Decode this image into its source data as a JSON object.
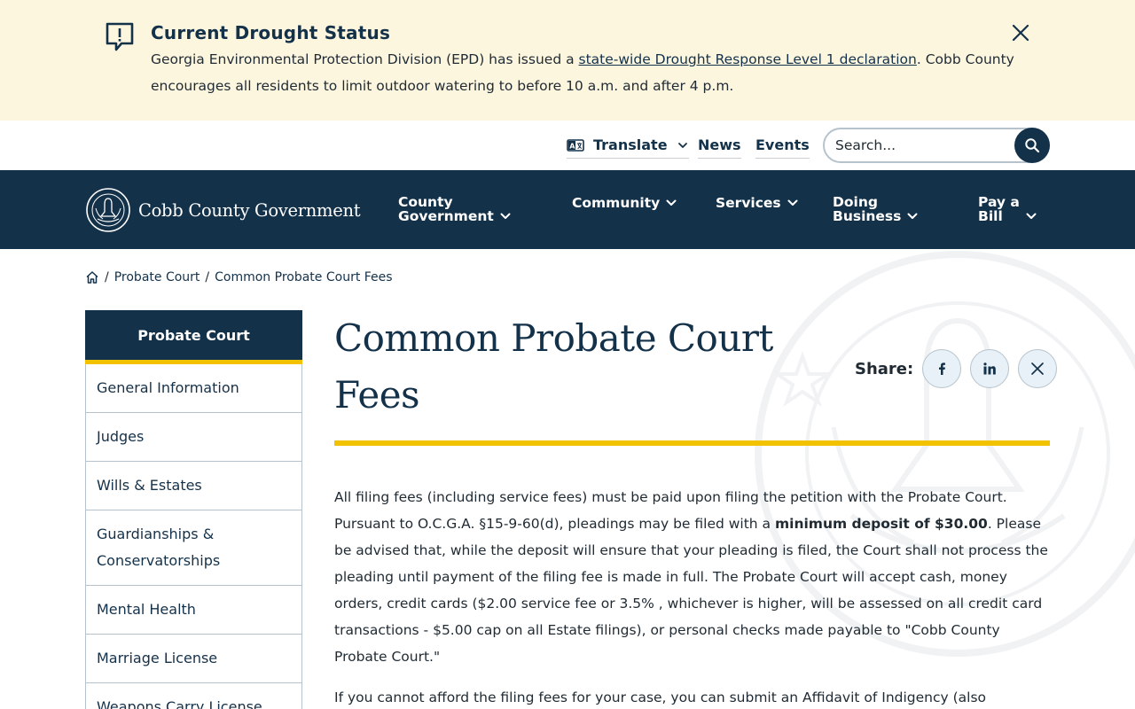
{
  "alert": {
    "icon": "alert-message-icon",
    "title": "Current Drought Status",
    "body_before": "Georgia Environmental Protection Division (EPD) has issued a ",
    "link_text": "state-wide Drought Response Level 1 declaration",
    "body_after": ". Cobb County encourages all residents to limit outdoor watering to before 10 a.m. and after 4 p.m.",
    "close_icon": "close-icon"
  },
  "utility": {
    "translate_label": "Translate",
    "news_label": "News",
    "events_label": "Events",
    "search_placeholder": "Search..."
  },
  "nav": {
    "logo_text": "Cobb County Government",
    "items": [
      {
        "label": "County\nGovernment"
      },
      {
        "label": "Community"
      },
      {
        "label": "Services"
      },
      {
        "label": "Doing\nBusiness"
      },
      {
        "label": "Pay a\nBill"
      }
    ]
  },
  "breadcrumb": {
    "home_icon": "home-icon",
    "items": [
      "Probate Court",
      "Common Probate Court Fees"
    ]
  },
  "sidebar": {
    "title": "Probate Court",
    "items": [
      {
        "label": "General Information"
      },
      {
        "label": "Judges"
      },
      {
        "label": "Wills & Estates"
      },
      {
        "label": "Guardianships & Conservatorships"
      },
      {
        "label": "Mental Health"
      },
      {
        "label": "Marriage License"
      },
      {
        "label": "Weapons Carry License"
      }
    ]
  },
  "main": {
    "title": "Common Probate Court Fees",
    "share_label": "Share:",
    "share_icons": [
      "facebook-icon",
      "linkedin-icon",
      "x-icon"
    ],
    "para1_a": "All filing fees (including service fees) must be paid upon filing the petition with the Probate Court. Pursuant to O.C.G.A. §15-9-60(d), pleadings may be filed with a ",
    "para1_bold": "minimum deposit of $30.00",
    "para1_b": ".  Please be advised that, while the deposit will ensure that your pleading is filed, the Court shall not process the pleading until payment of the filing fee is made in full.  The Probate Court will accept cash, money orders, credit cards ($2.00 service fee or 3.5% , whichever is higher, will be assessed on all credit card transactions - $5.00 cap on all Estate filings), or personal checks made payable to \"Cobb County Probate Court.\"",
    "para2": "If you cannot afford the filing fees for your case, you can submit an Affidavit of Indigency (also"
  },
  "colors": {
    "navy": "#14314a",
    "gold": "#f2c200",
    "alert_bg": "#fdf6df"
  }
}
